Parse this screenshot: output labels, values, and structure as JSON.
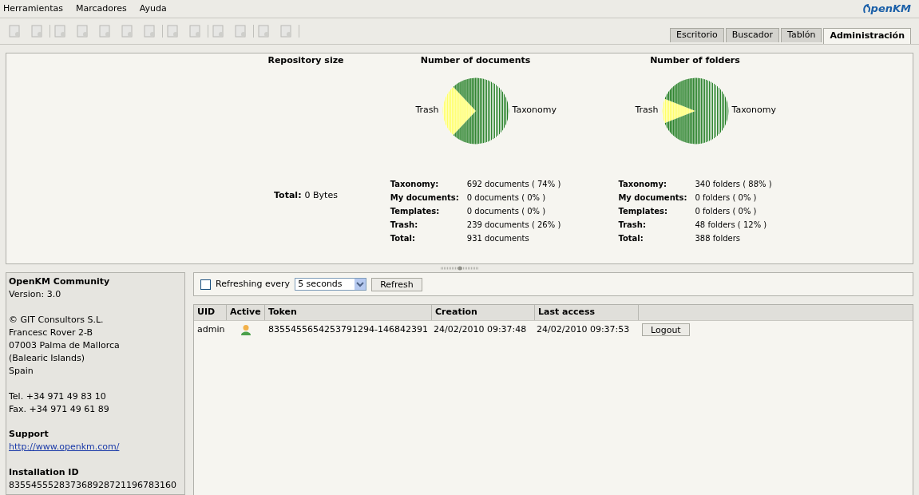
{
  "menu": [
    "Herramientas",
    "Marcadores",
    "Ayuda"
  ],
  "logo": {
    "text": "penKM"
  },
  "tabs": [
    {
      "label": "Escritorio",
      "selected": false
    },
    {
      "label": "Buscador",
      "selected": false
    },
    {
      "label": "Tablón",
      "selected": false
    },
    {
      "label": "Administración",
      "selected": true
    }
  ],
  "repository_size": {
    "title": "Repository size",
    "total_label": "Total:",
    "total_value": "0 Bytes"
  },
  "stats": [
    {
      "chart_data": {
        "type": "pie",
        "title": "Number of documents",
        "categories": [
          "Trash",
          "Taxonomy"
        ],
        "values": [
          26,
          74
        ]
      },
      "rows": [
        {
          "label": "Taxonomy:",
          "value": "692 documents ( 74% )"
        },
        {
          "label": "My documents:",
          "value": "0 documents ( 0% )"
        },
        {
          "label": "Templates:",
          "value": "0 documents ( 0% )"
        },
        {
          "label": "Trash:",
          "value": "239 documents ( 26% )"
        },
        {
          "label": "Total:",
          "value": "931 documents"
        }
      ]
    },
    {
      "chart_data": {
        "type": "pie",
        "title": "Number of folders",
        "categories": [
          "Trash",
          "Taxonomy"
        ],
        "values": [
          12,
          88
        ]
      },
      "rows": [
        {
          "label": "Taxonomy:",
          "value": "340 folders ( 88% )"
        },
        {
          "label": "My documents:",
          "value": "0 folders ( 0% )"
        },
        {
          "label": "Templates:",
          "value": "0 folders ( 0% )"
        },
        {
          "label": "Trash:",
          "value": "48 folders ( 12% )"
        },
        {
          "label": "Total:",
          "value": "388 folders"
        }
      ]
    }
  ],
  "about": {
    "product": "OpenKM Community",
    "version": "Version: 3.0",
    "address": [
      "© GIT Consultors S.L.",
      "Francesc Rover 2-B",
      "07003 Palma de Mallorca",
      "(Balearic Islands)",
      "Spain"
    ],
    "phones": [
      "Tel. +34 971 49 83 10",
      "Fax. +34 971 49 61 89"
    ],
    "support_title": "Support",
    "support_link": "http://www.openkm.com/",
    "installation_title": "Installation ID",
    "installation_id": "835545552837368928721196783160"
  },
  "refresh": {
    "checked": false,
    "label": "Refreshing every",
    "interval": "5 seconds",
    "button": "Refresh"
  },
  "table": {
    "columns": [
      "UID",
      "Active",
      "Token",
      "Creation",
      "Last access"
    ],
    "rows": [
      {
        "uid": "admin",
        "active": true,
        "token": "8355455654253791294-146842391",
        "creation": "24/02/2010 09:37:48",
        "last_access": "24/02/2010 09:37:53",
        "action": "Logout"
      }
    ]
  }
}
